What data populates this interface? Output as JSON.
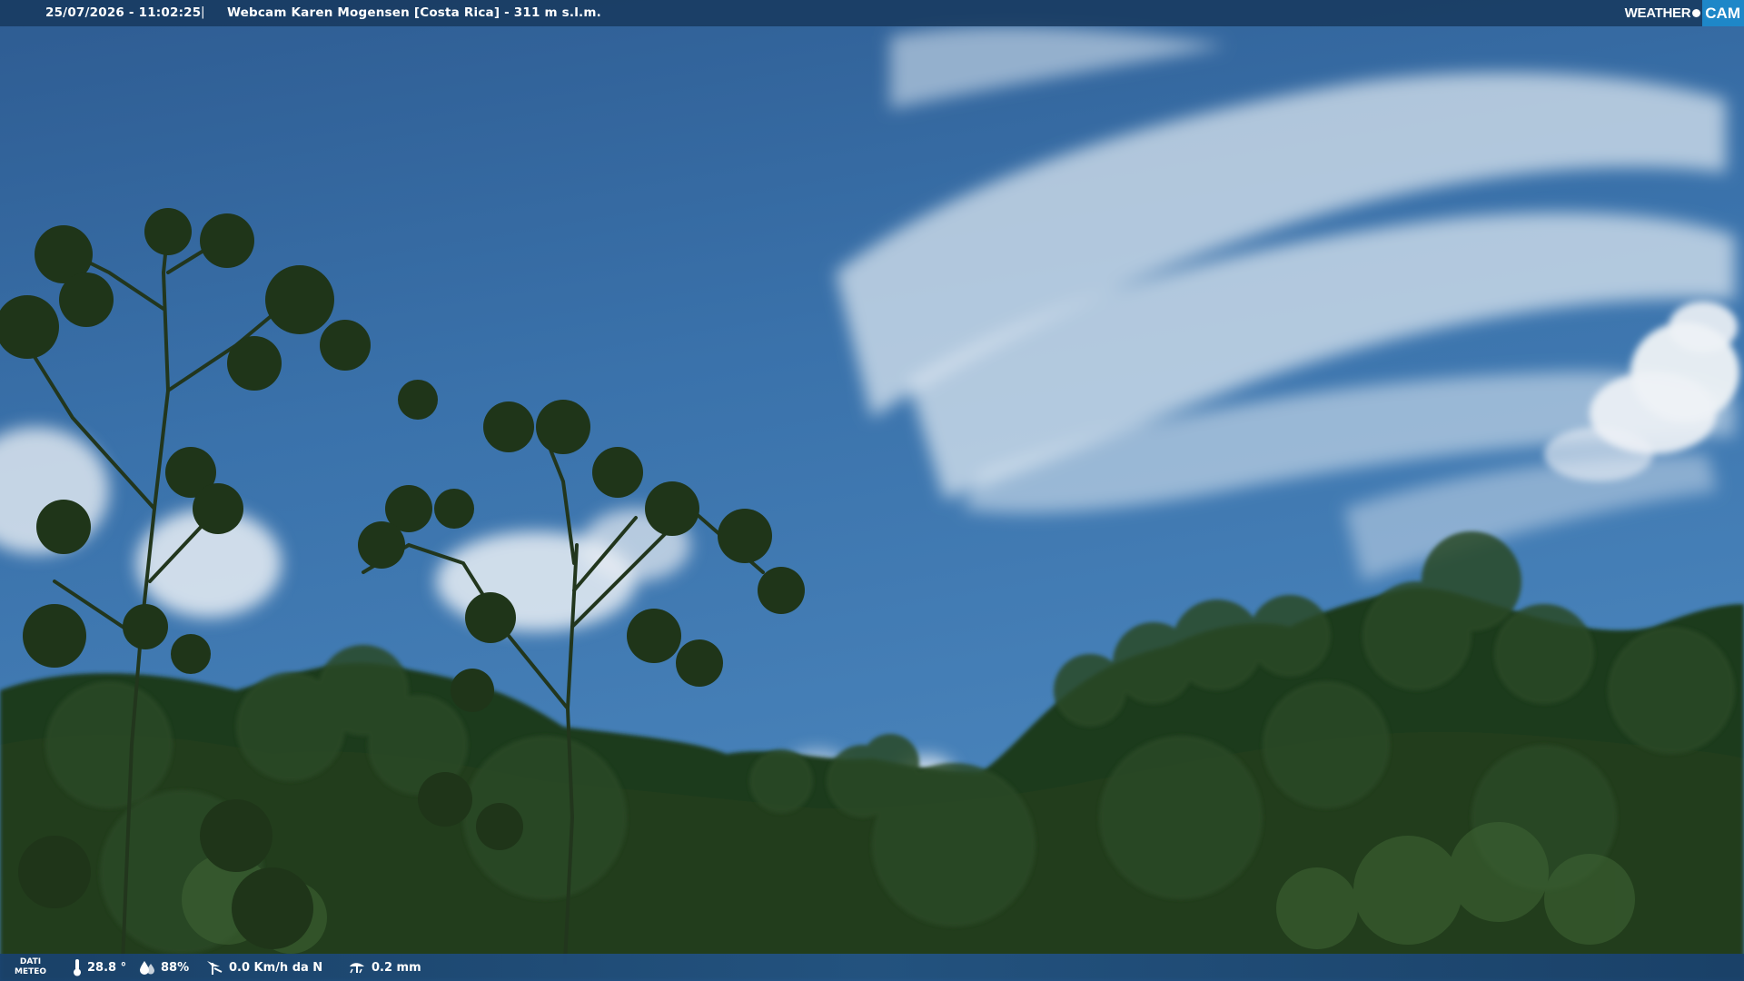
{
  "overlay": {
    "timestamp": "25/07/2026 - 11:02:25",
    "separator": "|",
    "camera_title": "Webcam Karen Mogensen [Costa Rica]  - 311 m s.l.m."
  },
  "logo": {
    "word": "WEATHER",
    "cam": "CAM"
  },
  "weather_bar": {
    "label_line1": "DATI",
    "label_line2": "METEO",
    "temperature": "28.8 °",
    "humidity": "88%",
    "wind": "0.0 Km/h da N",
    "rain": "0.2 mm"
  },
  "icons": {
    "temperature": "thermometer-icon",
    "humidity": "humidity-drop-icon",
    "wind": "wind-vane-icon",
    "rain": "rain-gauge-icon"
  },
  "colors": {
    "bar_bg": "#183a60",
    "logo_accent": "#1e87c8",
    "text": "#ffffff"
  }
}
